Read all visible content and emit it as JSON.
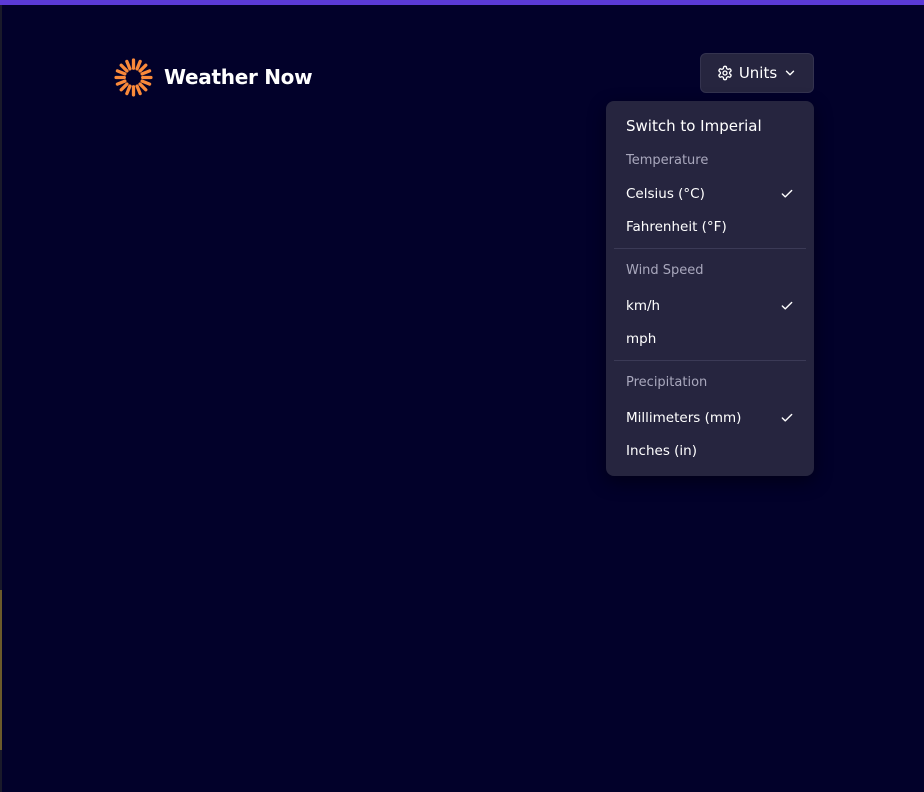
{
  "header": {
    "brand_name": "Weather Now",
    "logo_icon": "sun-logo-icon",
    "logo_color": "#f9893a",
    "units_button_label": "Units"
  },
  "units_menu": {
    "switch_label": "Switch to Imperial",
    "sections": [
      {
        "heading": "Temperature",
        "options": [
          {
            "label": "Celsius (°C)",
            "selected": true
          },
          {
            "label": "Fahrenheit (°F)",
            "selected": false
          }
        ]
      },
      {
        "heading": "Wind Speed",
        "options": [
          {
            "label": "km/h",
            "selected": true
          },
          {
            "label": "mph",
            "selected": false
          }
        ]
      },
      {
        "heading": "Precipitation",
        "options": [
          {
            "label": "Millimeters (mm)",
            "selected": true
          },
          {
            "label": "Inches (in)",
            "selected": false
          }
        ]
      }
    ]
  },
  "colors": {
    "background": "#02012a",
    "accent_bar": "#5b3ad6",
    "menu_surface": "#26253f"
  }
}
